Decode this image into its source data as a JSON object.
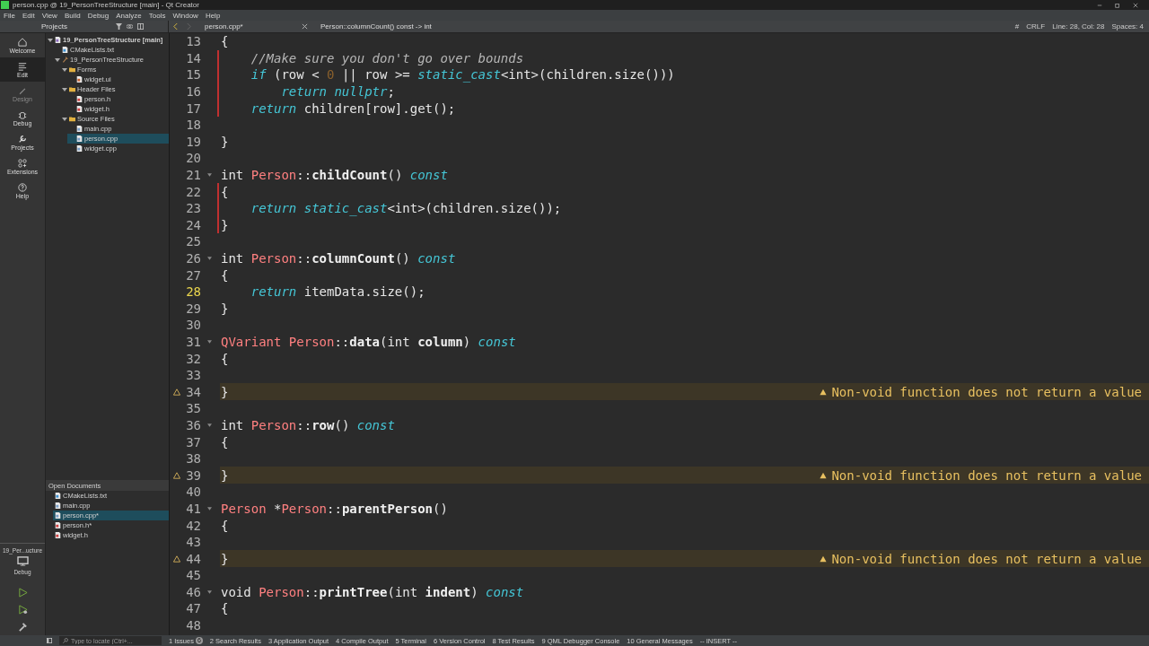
{
  "window": {
    "title": "person.cpp @ 19_PersonTreeStructure [main] - Qt Creator"
  },
  "menu": [
    "File",
    "Edit",
    "View",
    "Build",
    "Debug",
    "Analyze",
    "Tools",
    "Window",
    "Help"
  ],
  "modes": [
    {
      "label": "Welcome",
      "kind": "home",
      "selected": false,
      "disabled": false
    },
    {
      "label": "Edit",
      "kind": "edit",
      "selected": true,
      "disabled": false
    },
    {
      "label": "Design",
      "kind": "design",
      "selected": false,
      "disabled": true
    },
    {
      "label": "Debug",
      "kind": "debug",
      "selected": false,
      "disabled": false
    },
    {
      "label": "Projects",
      "kind": "projects",
      "selected": false,
      "disabled": false
    },
    {
      "label": "Extensions",
      "kind": "extensions",
      "selected": false,
      "disabled": false
    },
    {
      "label": "Help",
      "kind": "help",
      "selected": false,
      "disabled": false
    }
  ],
  "kit": {
    "project": "19_Per...ucture",
    "build": "Debug"
  },
  "projects_panel": {
    "title": "Projects",
    "tree": [
      {
        "label": "19_PersonTreeStructure [main]",
        "kind": "project",
        "selected": false,
        "expanded": true,
        "children": [
          {
            "label": "CMakeLists.txt",
            "kind": "cmake",
            "selected": false
          },
          {
            "label": "19_PersonTreeStructure",
            "kind": "target",
            "selected": false,
            "expanded": true,
            "children": [
              {
                "label": "Forms",
                "kind": "folder",
                "selected": false,
                "expanded": true,
                "children": [
                  {
                    "label": "widget.ui",
                    "kind": "ui",
                    "selected": false
                  }
                ]
              },
              {
                "label": "Header Files",
                "kind": "folder",
                "selected": false,
                "expanded": true,
                "children": [
                  {
                    "label": "person.h",
                    "kind": "header",
                    "selected": false
                  },
                  {
                    "label": "widget.h",
                    "kind": "header",
                    "selected": false
                  }
                ]
              },
              {
                "label": "Source Files",
                "kind": "folder",
                "selected": false,
                "expanded": true,
                "children": [
                  {
                    "label": "main.cpp",
                    "kind": "source",
                    "selected": false
                  },
                  {
                    "label": "person.cpp",
                    "kind": "source",
                    "selected": true
                  },
                  {
                    "label": "widget.cpp",
                    "kind": "source",
                    "selected": false
                  }
                ]
              }
            ]
          }
        ]
      }
    ]
  },
  "open_documents": {
    "title": "Open Documents",
    "items": [
      {
        "label": "CMakeLists.txt",
        "kind": "cmake",
        "selected": false
      },
      {
        "label": "main.cpp",
        "kind": "source",
        "selected": false
      },
      {
        "label": "person.cpp*",
        "kind": "source",
        "selected": true
      },
      {
        "label": "person.h*",
        "kind": "header",
        "selected": false
      },
      {
        "label": "widget.h",
        "kind": "header",
        "selected": false
      }
    ]
  },
  "editor_toolbar": {
    "file": "person.cpp*",
    "symbol": "Person::columnCount() const -> int",
    "hash": "#",
    "line_ending": "CRLF",
    "position": "Line: 28, Col: 28",
    "indent": "Spaces: 4"
  },
  "code": {
    "lines": [
      {
        "number": "13",
        "current": false,
        "modified": false,
        "fold": false,
        "tokens": [
          {
            "kind": "plain",
            "text": "{"
          }
        ]
      },
      {
        "number": "14",
        "current": false,
        "modified": true,
        "fold": false,
        "tokens": [
          {
            "kind": "comment",
            "text": "    //Make sure you don't go over bounds"
          }
        ]
      },
      {
        "number": "15",
        "current": false,
        "modified": true,
        "fold": false,
        "tokens": [
          {
            "kind": "keyword",
            "text": "    if"
          },
          {
            "kind": "plain",
            "text": " (row < "
          },
          {
            "kind": "number",
            "text": "0"
          },
          {
            "kind": "plain",
            "text": " || row >= "
          },
          {
            "kind": "keyword",
            "text": "static_cast"
          },
          {
            "kind": "plain",
            "text": "<int>(children.size()))"
          }
        ]
      },
      {
        "number": "16",
        "current": false,
        "modified": true,
        "fold": false,
        "tokens": [
          {
            "kind": "keyword",
            "text": "        return nullptr"
          },
          {
            "kind": "plain",
            "text": ";"
          }
        ]
      },
      {
        "number": "17",
        "current": false,
        "modified": true,
        "fold": false,
        "tokens": [
          {
            "kind": "keyword",
            "text": "    return"
          },
          {
            "kind": "plain",
            "text": " children[row].get();"
          }
        ]
      },
      {
        "number": "18",
        "current": false,
        "modified": false,
        "fold": false
      },
      {
        "number": "19",
        "current": false,
        "modified": false,
        "fold": false,
        "tokens": [
          {
            "kind": "plain",
            "text": "}"
          }
        ]
      },
      {
        "number": "20",
        "current": false,
        "modified": false,
        "fold": false
      },
      {
        "number": "21",
        "current": false,
        "modified": false,
        "fold": true,
        "tokens": [
          {
            "kind": "plain",
            "text": "int "
          },
          {
            "kind": "type",
            "text": "Person"
          },
          {
            "kind": "plain",
            "text": "::"
          },
          {
            "kind": "function",
            "text": "childCount"
          },
          {
            "kind": "plain",
            "text": "() "
          },
          {
            "kind": "keyword",
            "text": "const"
          }
        ]
      },
      {
        "number": "22",
        "current": false,
        "modified": true,
        "fold": false,
        "tokens": [
          {
            "kind": "plain",
            "text": "{"
          }
        ]
      },
      {
        "number": "23",
        "current": false,
        "modified": true,
        "fold": false,
        "tokens": [
          {
            "kind": "keyword",
            "text": "    return static_cast"
          },
          {
            "kind": "plain",
            "text": "<int>(children.size());"
          }
        ]
      },
      {
        "number": "24",
        "current": false,
        "modified": true,
        "fold": false,
        "tokens": [
          {
            "kind": "plain",
            "text": "}"
          }
        ]
      },
      {
        "number": "25",
        "current": false,
        "modified": false,
        "fold": false
      },
      {
        "number": "26",
        "current": false,
        "modified": false,
        "fold": true,
        "tokens": [
          {
            "kind": "plain",
            "text": "int "
          },
          {
            "kind": "type",
            "text": "Person"
          },
          {
            "kind": "plain",
            "text": "::"
          },
          {
            "kind": "function",
            "text": "columnCount"
          },
          {
            "kind": "plain",
            "text": "() "
          },
          {
            "kind": "keyword",
            "text": "const"
          }
        ]
      },
      {
        "number": "27",
        "current": false,
        "modified": false,
        "fold": false,
        "tokens": [
          {
            "kind": "plain",
            "text": "{"
          }
        ]
      },
      {
        "number": "28",
        "current": true,
        "modified": false,
        "fold": false,
        "tokens": [
          {
            "kind": "keyword",
            "text": "    return"
          },
          {
            "kind": "plain",
            "text": " itemData.size();"
          }
        ]
      },
      {
        "number": "29",
        "current": false,
        "modified": false,
        "fold": false,
        "tokens": [
          {
            "kind": "plain",
            "text": "}"
          }
        ]
      },
      {
        "number": "30",
        "current": false,
        "modified": false,
        "fold": false
      },
      {
        "number": "31",
        "current": false,
        "modified": false,
        "fold": true,
        "tokens": [
          {
            "kind": "type",
            "text": "QVariant Person"
          },
          {
            "kind": "plain",
            "text": "::"
          },
          {
            "kind": "function",
            "text": "data"
          },
          {
            "kind": "plain",
            "text": "(int "
          },
          {
            "kind": "function",
            "text": "column"
          },
          {
            "kind": "plain",
            "text": ") "
          },
          {
            "kind": "keyword",
            "text": "const"
          }
        ]
      },
      {
        "number": "32",
        "current": false,
        "modified": false,
        "fold": false,
        "tokens": [
          {
            "kind": "plain",
            "text": "{"
          }
        ]
      },
      {
        "number": "33",
        "current": false,
        "modified": false,
        "fold": false
      },
      {
        "number": "34",
        "current": false,
        "modified": false,
        "fold": false,
        "tokens": [
          {
            "kind": "plain",
            "text": "}"
          }
        ],
        "warning": "Non-void function does not return a value"
      },
      {
        "number": "35",
        "current": false,
        "modified": false,
        "fold": false
      },
      {
        "number": "36",
        "current": false,
        "modified": false,
        "fold": true,
        "tokens": [
          {
            "kind": "plain",
            "text": "int "
          },
          {
            "kind": "type",
            "text": "Person"
          },
          {
            "kind": "plain",
            "text": "::"
          },
          {
            "kind": "function",
            "text": "row"
          },
          {
            "kind": "plain",
            "text": "() "
          },
          {
            "kind": "keyword",
            "text": "const"
          }
        ]
      },
      {
        "number": "37",
        "current": false,
        "modified": false,
        "fold": false,
        "tokens": [
          {
            "kind": "plain",
            "text": "{"
          }
        ]
      },
      {
        "number": "38",
        "current": false,
        "modified": false,
        "fold": false
      },
      {
        "number": "39",
        "current": false,
        "modified": false,
        "fold": false,
        "tokens": [
          {
            "kind": "plain",
            "text": "}"
          }
        ],
        "warning": "Non-void function does not return a value"
      },
      {
        "number": "40",
        "current": false,
        "modified": false,
        "fold": false
      },
      {
        "number": "41",
        "current": false,
        "modified": false,
        "fold": true,
        "tokens": [
          {
            "kind": "type",
            "text": "Person"
          },
          {
            "kind": "plain",
            "text": " *"
          },
          {
            "kind": "type",
            "text": "Person"
          },
          {
            "kind": "plain",
            "text": "::"
          },
          {
            "kind": "function",
            "text": "parentPerson"
          },
          {
            "kind": "plain",
            "text": "()"
          }
        ]
      },
      {
        "number": "42",
        "current": false,
        "modified": false,
        "fold": false,
        "tokens": [
          {
            "kind": "plain",
            "text": "{"
          }
        ]
      },
      {
        "number": "43",
        "current": false,
        "modified": false,
        "fold": false
      },
      {
        "number": "44",
        "current": false,
        "modified": false,
        "fold": false,
        "tokens": [
          {
            "kind": "plain",
            "text": "}"
          }
        ],
        "warning": "Non-void function does not return a value"
      },
      {
        "number": "45",
        "current": false,
        "modified": false,
        "fold": false
      },
      {
        "number": "46",
        "current": false,
        "modified": false,
        "fold": true,
        "tokens": [
          {
            "kind": "plain",
            "text": "void "
          },
          {
            "kind": "type",
            "text": "Person"
          },
          {
            "kind": "plain",
            "text": "::"
          },
          {
            "kind": "function",
            "text": "printTree"
          },
          {
            "kind": "plain",
            "text": "(int "
          },
          {
            "kind": "function",
            "text": "indent"
          },
          {
            "kind": "plain",
            "text": ") "
          },
          {
            "kind": "keyword",
            "text": "const"
          }
        ]
      },
      {
        "number": "47",
        "current": false,
        "modified": false,
        "fold": false,
        "tokens": [
          {
            "kind": "plain",
            "text": "{"
          }
        ]
      },
      {
        "number": "48",
        "current": false,
        "modified": false,
        "fold": false
      }
    ]
  },
  "status_bar": {
    "locate_placeholder": "Type to locate (Ctrl+...",
    "panes": [
      {
        "label": "1 Issues",
        "badge": "6"
      },
      {
        "label": "2 Search Results"
      },
      {
        "label": "3 Application Output"
      },
      {
        "label": "4 Compile Output"
      },
      {
        "label": "5 Terminal"
      },
      {
        "label": "6 Version Control"
      },
      {
        "label": "8 Test Results"
      },
      {
        "label": "9 QML Debugger Console"
      },
      {
        "label": "10 General Messages"
      }
    ],
    "mode": "-- INSERT --"
  }
}
